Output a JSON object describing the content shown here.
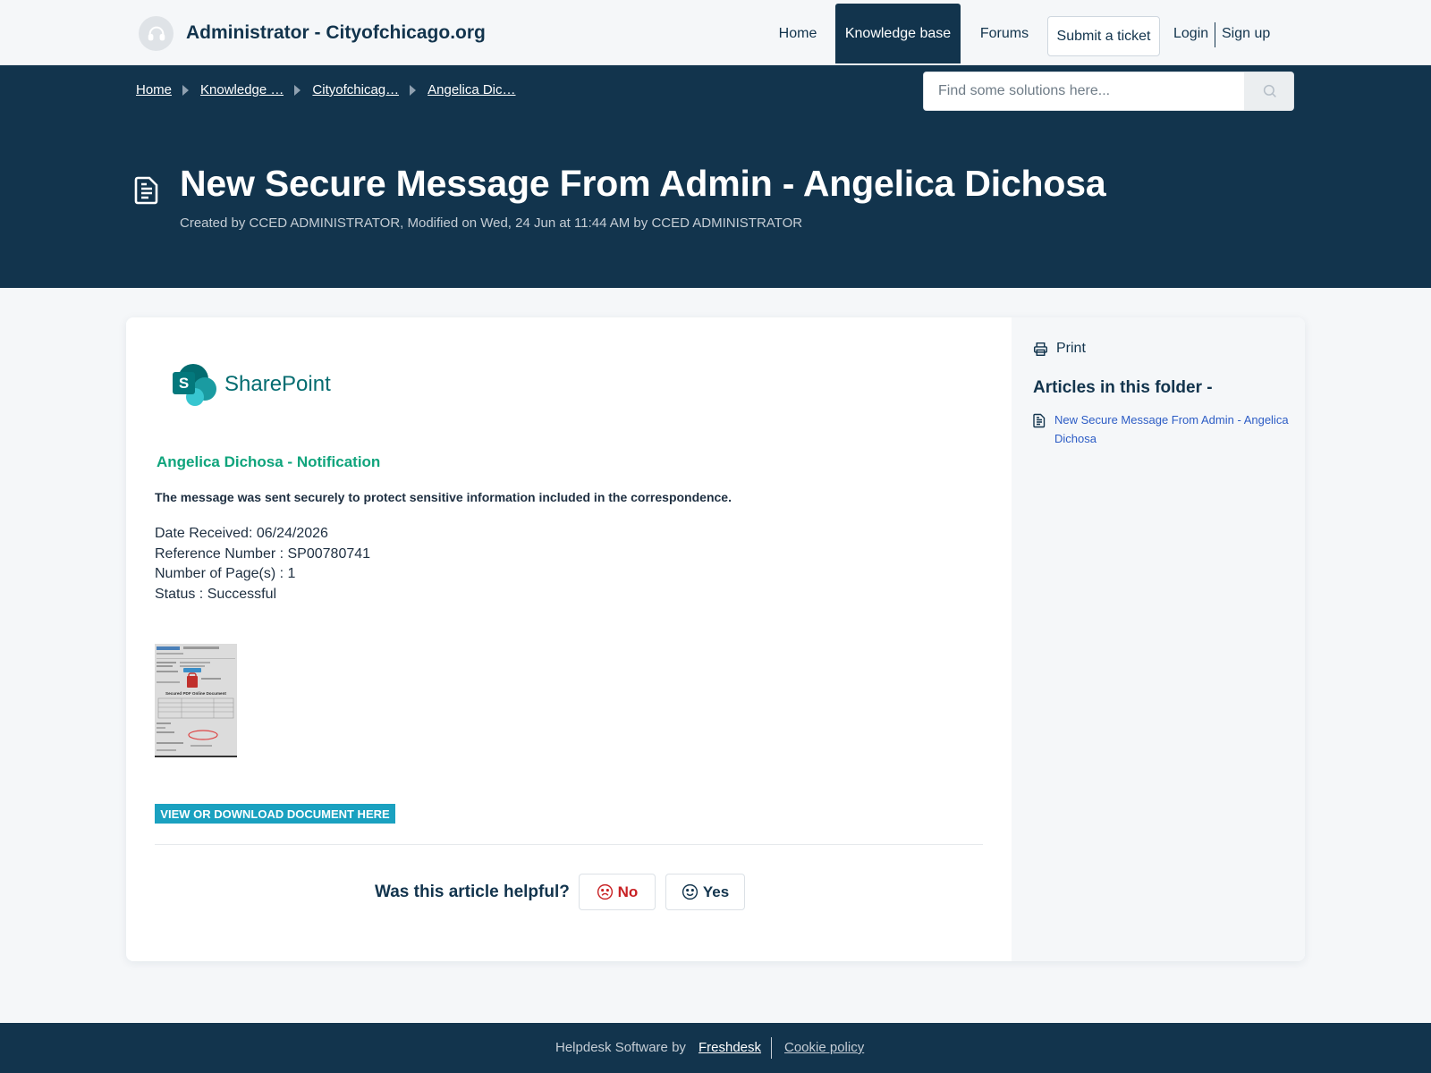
{
  "header": {
    "brand": "Administrator - Cityofchicago.org",
    "nav": {
      "home": "Home",
      "knowledge_base": "Knowledge base",
      "forums": "Forums",
      "submit_ticket": "Submit a ticket",
      "login": "Login",
      "signup": "Sign up"
    }
  },
  "breadcrumb": [
    "Home",
    "Knowledge …",
    "Cityofchicag…",
    "Angelica Dic…"
  ],
  "search": {
    "placeholder": "Find some solutions here..."
  },
  "article": {
    "title": "New Secure Message From Admin - Angelica Dichosa",
    "meta": "Created by CCED ADMINISTRATOR, Modified on Wed, 24 Jun at 11:44 AM by CCED ADMINISTRATOR",
    "logo_text": "SharePoint",
    "notification_title": "Angelica Dichosa - Notification",
    "secure_message": "The message was sent securely to protect sensitive information included in the correspondence.",
    "details": [
      "Date Received: 06/24/2026",
      "Reference Number : SP00780741",
      "Number of Page(s) : 1",
      "Status : Successful"
    ],
    "thumb_caption": "Secured PDF Online Document",
    "download_label": "VIEW OR DOWNLOAD DOCUMENT HERE",
    "helpful_question": "Was this article helpful?",
    "vote_no": "No",
    "vote_yes": "Yes"
  },
  "sidebar": {
    "print": "Print",
    "folder_title": "Articles in this folder -",
    "articles": [
      "New Secure Message From Admin - Angelica Dichosa"
    ]
  },
  "footer": {
    "label": "Helpdesk Software by",
    "freshdesk": "Freshdesk",
    "cookie": "Cookie policy"
  },
  "colors": {
    "navy": "#12344d",
    "accent_green": "#0fa47c",
    "download_blue": "#1aa1c0",
    "no_red": "#c82124",
    "link_blue": "#2c5cc5"
  },
  "icons": [
    "headset-icon",
    "search-icon",
    "document-icon",
    "print-icon",
    "sad-face-icon",
    "smile-face-icon",
    "chevron-right-icon"
  ]
}
